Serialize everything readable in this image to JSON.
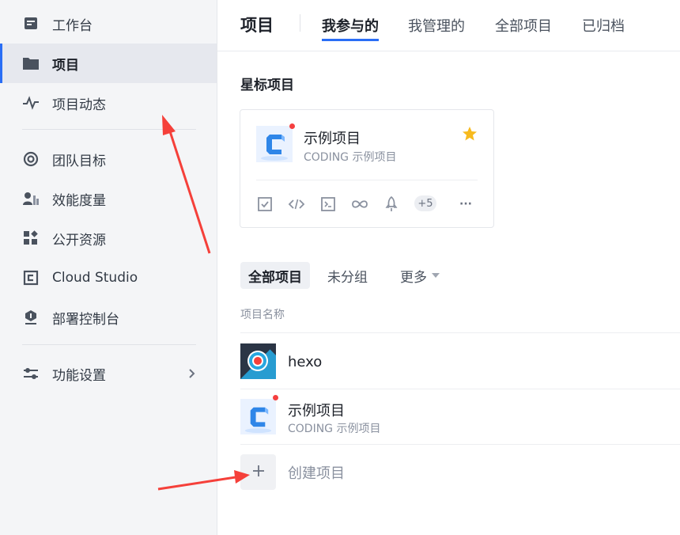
{
  "sidebar": {
    "items": [
      {
        "label": "工作台",
        "icon": "dashboard-icon"
      },
      {
        "label": "项目",
        "icon": "folder-icon",
        "active": true
      },
      {
        "label": "项目动态",
        "icon": "activity-icon"
      },
      {
        "label": "团队目标",
        "icon": "target-icon"
      },
      {
        "label": "效能度量",
        "icon": "people-chart-icon"
      },
      {
        "label": "公开资源",
        "icon": "resources-icon"
      },
      {
        "label": "Cloud Studio",
        "icon": "cloud-studio-icon"
      },
      {
        "label": "部署控制台",
        "icon": "deploy-icon"
      },
      {
        "label": "功能设置",
        "icon": "settings-sliders-icon"
      }
    ]
  },
  "header": {
    "title": "项目",
    "tabs": [
      {
        "label": "我参与的",
        "active": true
      },
      {
        "label": "我管理的"
      },
      {
        "label": "全部项目"
      },
      {
        "label": "已归档"
      }
    ]
  },
  "starred": {
    "title": "星标项目",
    "card": {
      "name": "示例项目",
      "description": "CODING 示例项目",
      "more_count": "+5",
      "more": "···"
    }
  },
  "groups": {
    "tabs": [
      {
        "label": "全部项目",
        "active": true
      },
      {
        "label": "未分组"
      },
      {
        "label": "更多"
      }
    ]
  },
  "table": {
    "column_header": "项目名称",
    "rows": [
      {
        "name": "hexo",
        "description": ""
      },
      {
        "name": "示例项目",
        "description": "CODING 示例项目"
      }
    ]
  },
  "create": {
    "label": "创建项目"
  },
  "colors": {
    "accent": "#2a6ef5",
    "arrow": "#f5403a",
    "badge": "#f53f3f",
    "star": "#f7ba1e"
  }
}
